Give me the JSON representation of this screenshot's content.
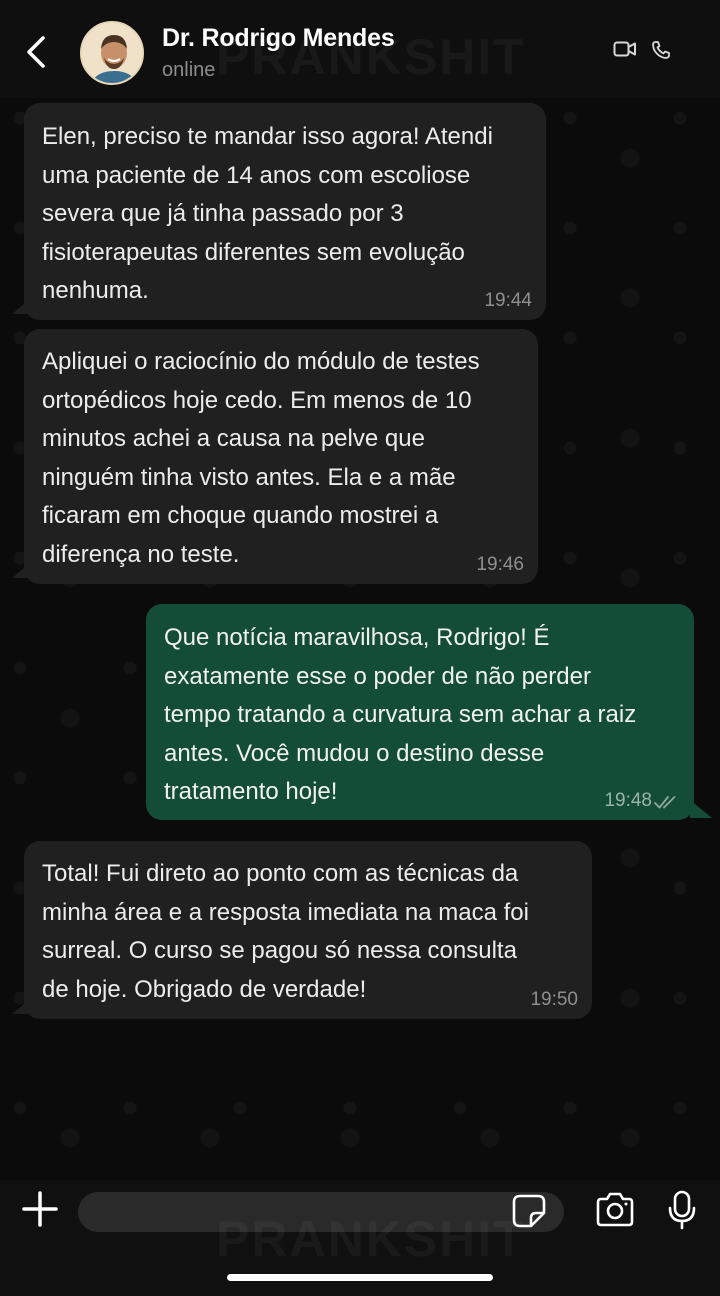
{
  "header": {
    "back_icon": "chevron-left-icon",
    "contact_name": "Dr. Rodrigo Mendes",
    "status": "online",
    "video_icon": "video-camera-icon",
    "phone_icon": "phone-icon"
  },
  "watermark": "PRANKSHIT",
  "messages": [
    {
      "direction": "incoming",
      "text": "Elen, preciso te mandar isso agora! Atendi\numa paciente de 14 anos com escoliose\nsevera que já tinha passado por 3\nfisioterapeutas diferentes sem evolução\nnenhuma.",
      "time": "19:44"
    },
    {
      "direction": "incoming",
      "text": "Apliquei o raciocínio do módulo de testes\nortopédicos hoje cedo. Em menos de 10\nminutos achei a causa na pelve que\nninguém tinha visto antes. Ela e a mãe\nficaram em choque quando mostrei a\ndiferença no teste.",
      "time": "19:46"
    },
    {
      "direction": "outgoing",
      "text": "Que notícia maravilhosa, Rodrigo! É\nexatamente esse o poder de não perder\ntempo tratando a curvatura sem achar a raiz\nantes. Você mudou o destino desse\ntratamento hoje!",
      "time": "19:48",
      "status_icon": "double-check-icon"
    },
    {
      "direction": "incoming",
      "text": "Total! Fui direto ao ponto com as técnicas da\nminha área e a resposta imediata na maca foi\nsurreal. O curso se pagou só nessa consulta\nde hoje. Obrigado de verdade!",
      "time": "19:50"
    }
  ],
  "input_bar": {
    "plus_icon": "plus-icon",
    "message_placeholder": "",
    "sticker_icon": "sticker-icon",
    "camera_icon": "camera-icon",
    "mic_icon": "microphone-icon"
  },
  "colors": {
    "background": "#0b0b0b",
    "incoming_bubble": "#202020",
    "outgoing_bubble": "#144d37",
    "timestamp": "#8f8f8f"
  }
}
